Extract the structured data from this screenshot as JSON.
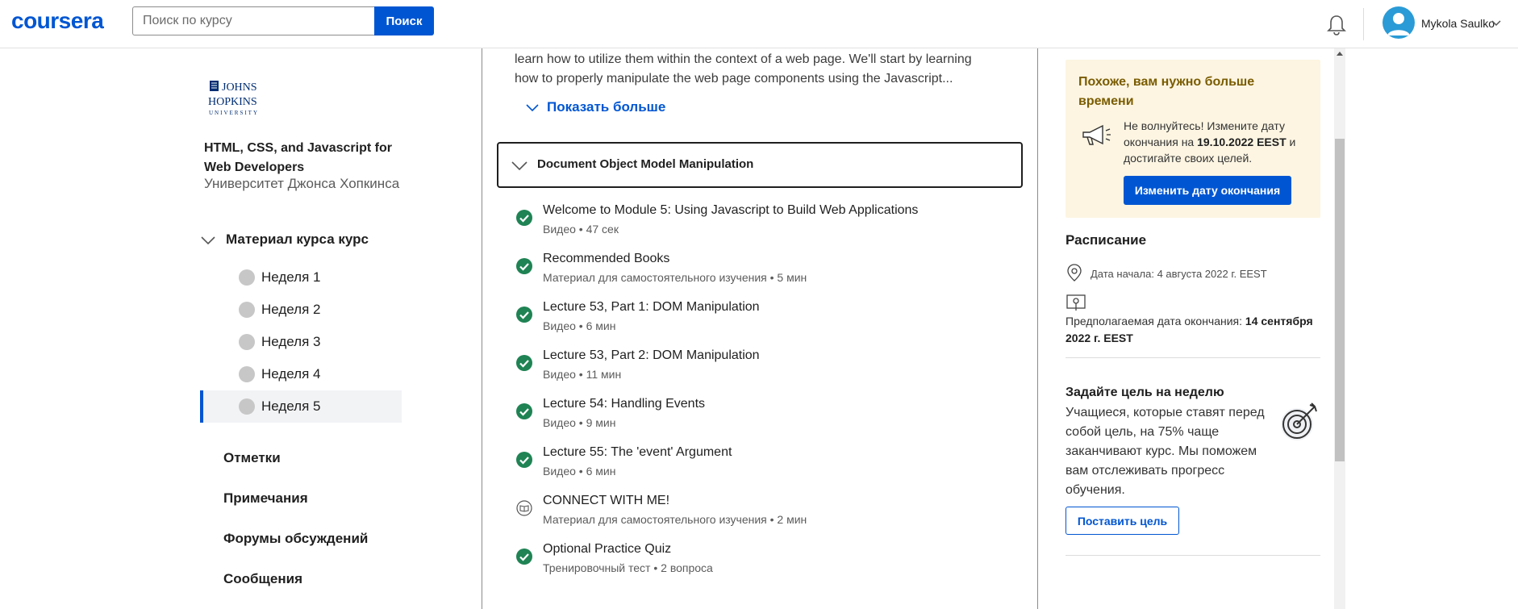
{
  "header": {
    "logo": "coursera",
    "search_placeholder": "Поиск по курсу",
    "search_button": "Поиск",
    "user_name": "Mykola Saulko"
  },
  "sidebar": {
    "university_logo_text": "JOHNS HOPKINS UNIVERSITY",
    "course_title": "HTML, CSS, and Javascript for Web Developers",
    "course_university": "Университет Джонса Хопкинса",
    "material_label": "Материал курса курс",
    "weeks": [
      {
        "label": "Неделя 1",
        "active": false
      },
      {
        "label": "Неделя 2",
        "active": false
      },
      {
        "label": "Неделя 3",
        "active": false
      },
      {
        "label": "Неделя 4",
        "active": false
      },
      {
        "label": "Неделя 5",
        "active": true
      }
    ],
    "nav": {
      "grades": "Отметки",
      "notes": "Примечания",
      "forums": "Форумы обсуждений",
      "messages": "Сообщения"
    }
  },
  "main": {
    "description": "learn how to utilize them within the context of a web page. We'll start by learning how to properly manipulate the web page components using the Javascript...",
    "show_more": "Показать больше",
    "module_title": "Document Object Model Manipulation",
    "items": [
      {
        "title": "Welcome to Module 5: Using Javascript to Build Web Applications",
        "meta": "Видео • 47 сек",
        "status": "completed"
      },
      {
        "title": "Recommended Books",
        "meta": "Материал для самостоятельного изучения • 5 мин",
        "status": "completed"
      },
      {
        "title": "Lecture 53, Part 1: DOM Manipulation",
        "meta": "Видео • 6 мин",
        "status": "completed"
      },
      {
        "title": "Lecture 53, Part 2: DOM Manipulation",
        "meta": "Видео • 11 мин",
        "status": "completed"
      },
      {
        "title": "Lecture 54: Handling Events",
        "meta": "Видео • 9 мин",
        "status": "completed"
      },
      {
        "title": "Lecture 55: The 'event' Argument",
        "meta": "Видео • 6 мин",
        "status": "completed"
      },
      {
        "title": "CONNECT WITH ME!",
        "meta": "Материал для самостоятельного изучения • 2 мин",
        "status": "reading"
      },
      {
        "title": "Optional Practice Quiz",
        "meta": "Тренировочный тест • 2 вопроса",
        "status": "completed"
      }
    ]
  },
  "right": {
    "notice": {
      "title": "Похоже, вам нужно больше времени",
      "text_before": "Не волнуйтесь! Измените дату окончания на ",
      "date": "19.10.2022 EEST",
      "text_after": " и достигайте своих целей.",
      "button": "Изменить дату окончания"
    },
    "schedule": {
      "title": "Расписание",
      "start": "Дата начала: 4 августа 2022 г. EEST",
      "end_label": "Предполагаемая дата окончания: ",
      "end_date": "14 сентября 2022 г. EEST"
    },
    "goal": {
      "title": "Задайте цель на неделю",
      "text": "Учащиеся, которые ставят перед собой цель, на 75% чаще заканчивают курс. Мы поможем вам отслеживать прогресс обучения.",
      "button": "Поставить цель"
    }
  },
  "colors": {
    "brand": "#0056d2",
    "completed": "#1f8354",
    "notice_bg": "#fdf5e2"
  }
}
